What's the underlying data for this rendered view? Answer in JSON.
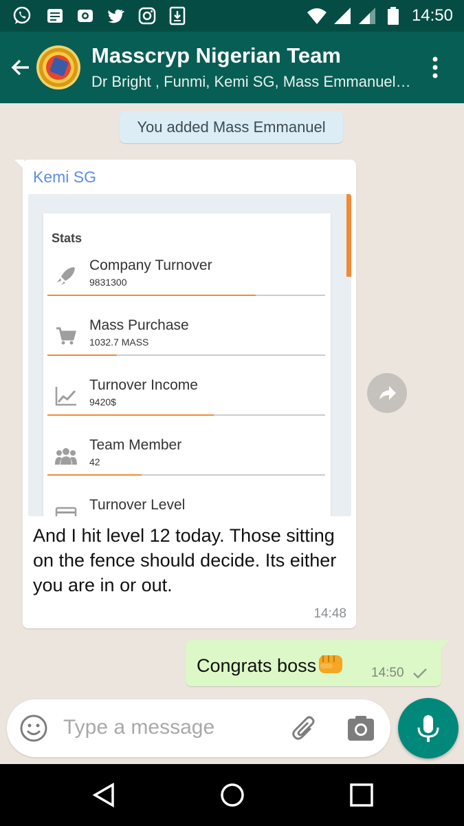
{
  "status_bar": {
    "time": "14:50"
  },
  "header": {
    "title": "Masscryp Nigerian Team",
    "subtitle": "Dr Bright , Funmi, Kemi SG, Mass Emmanuel, Mass Bello, Mass Precious"
  },
  "system_message": "You added Mass Emmanuel",
  "incoming": {
    "sender": "Kemi SG",
    "image": {
      "section_label": "Stats",
      "stats": [
        {
          "icon": "rocket-icon",
          "name": "Company Turnover",
          "value": "9831300",
          "progress": 0.75
        },
        {
          "icon": "cart-icon",
          "name": "Mass Purchase",
          "value": "1032.7 MASS",
          "progress": 0.25
        },
        {
          "icon": "chart-line-icon",
          "name": "Turnover Income",
          "value": "9420$",
          "progress": 0.6
        },
        {
          "icon": "group-icon",
          "name": "Team Member",
          "value": "42",
          "progress": 0.34
        },
        {
          "icon": "card-icon",
          "name": "Turnover Level",
          "value": "",
          "progress": 0
        }
      ]
    },
    "text": "And I hit level 12 today. Those sitting on the fence should decide. Its either you are in or out.",
    "time": "14:48"
  },
  "outgoing": {
    "text": "Congrats boss",
    "time": "14:50"
  },
  "input": {
    "placeholder": "Type a message"
  },
  "colors": {
    "header": "#075e54",
    "status": "#054d44",
    "accent": "#00897b",
    "bubble_out": "#dcf8c6",
    "progress": "#f48a33"
  }
}
